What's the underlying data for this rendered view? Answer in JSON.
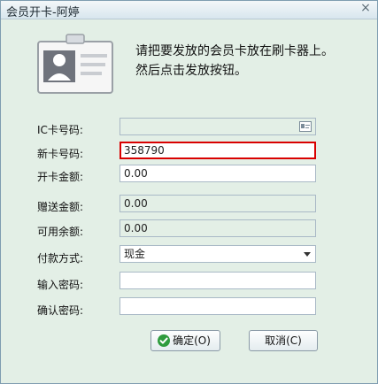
{
  "window": {
    "title": "会员开卡-阿婷",
    "close_glyph": "×"
  },
  "instruction": {
    "line1": "请把要发放的会员卡放在刷卡器上。",
    "line2": "然后点击发放按钮。"
  },
  "fields": {
    "ic_card_label": "IC卡号码:",
    "ic_card_value": "",
    "new_card_label": "新卡号码:",
    "new_card_value": "358790",
    "open_amount_label": "开卡金额:",
    "open_amount_value": "0.00",
    "gift_amount_label": "赠送金额:",
    "gift_amount_value": "0.00",
    "available_balance_label": "可用余额:",
    "available_balance_value": "0.00",
    "payment_method_label": "付款方式:",
    "payment_method_value": "现金",
    "password_label": "输入密码:",
    "password_value": "",
    "confirm_password_label": "确认密码:",
    "confirm_password_value": ""
  },
  "buttons": {
    "confirm_label": "确定(O)",
    "cancel_label": "取消(C)"
  },
  "colors": {
    "window_bg": "#e3efe6",
    "highlight_border": "#d90000"
  },
  "icons": {
    "card": "id-card-icon",
    "reader": "card-reader-icon",
    "confirm": "check-icon",
    "close": "close-icon",
    "dropdown": "chevron-down-icon"
  }
}
